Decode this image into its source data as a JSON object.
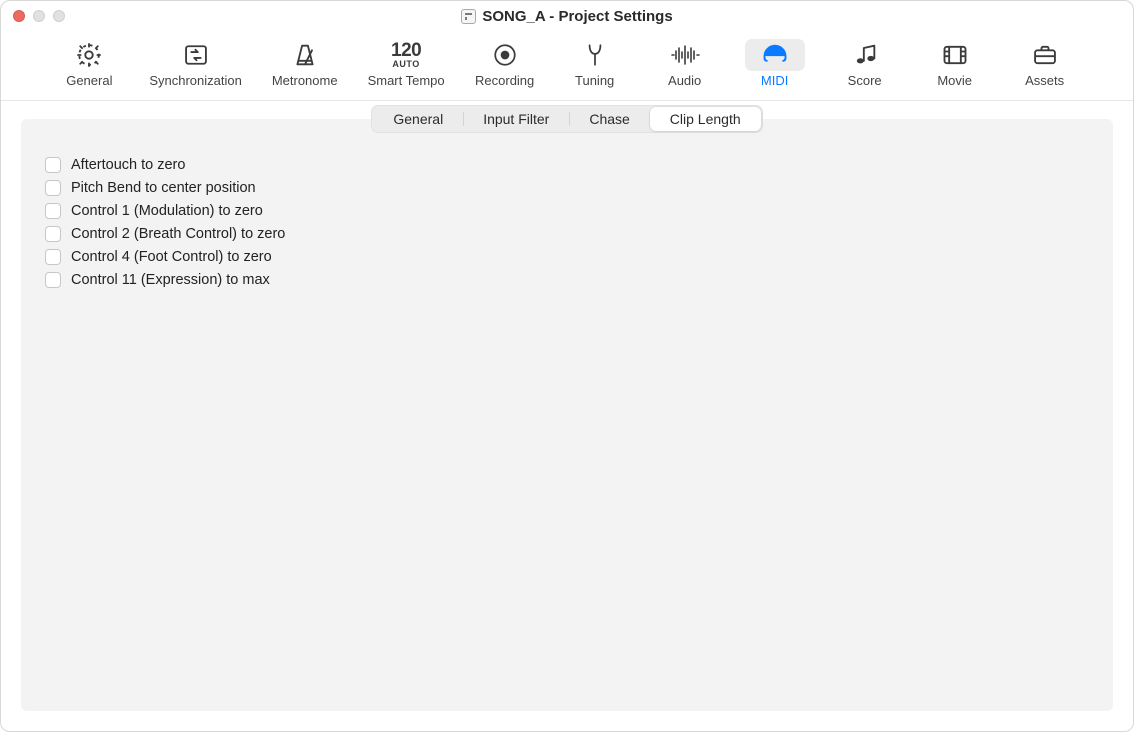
{
  "window": {
    "title": "SONG_A - Project Settings"
  },
  "toolbar": {
    "items": [
      {
        "id": "general",
        "label": "General"
      },
      {
        "id": "sync",
        "label": "Synchronization"
      },
      {
        "id": "metronome",
        "label": "Metronome"
      },
      {
        "id": "smart-tempo",
        "label": "Smart Tempo",
        "tempo": "120",
        "auto": "AUTO"
      },
      {
        "id": "recording",
        "label": "Recording"
      },
      {
        "id": "tuning",
        "label": "Tuning"
      },
      {
        "id": "audio",
        "label": "Audio"
      },
      {
        "id": "midi",
        "label": "MIDI",
        "active": true
      },
      {
        "id": "score",
        "label": "Score"
      },
      {
        "id": "movie",
        "label": "Movie"
      },
      {
        "id": "assets",
        "label": "Assets"
      }
    ]
  },
  "subtabs": {
    "items": [
      {
        "id": "general",
        "label": "General"
      },
      {
        "id": "input-filter",
        "label": "Input Filter"
      },
      {
        "id": "chase",
        "label": "Chase"
      },
      {
        "id": "clip-length",
        "label": "Clip Length",
        "active": true
      }
    ]
  },
  "options": [
    {
      "id": "aftertouch",
      "label": "Aftertouch to zero",
      "checked": false
    },
    {
      "id": "pitch-bend",
      "label": "Pitch Bend to center position",
      "checked": false
    },
    {
      "id": "cc1",
      "label": "Control 1 (Modulation) to zero",
      "checked": false
    },
    {
      "id": "cc2",
      "label": "Control 2 (Breath Control) to zero",
      "checked": false
    },
    {
      "id": "cc4",
      "label": "Control 4 (Foot Control) to zero",
      "checked": false
    },
    {
      "id": "cc11",
      "label": "Control 11 (Expression) to max",
      "checked": false
    }
  ]
}
